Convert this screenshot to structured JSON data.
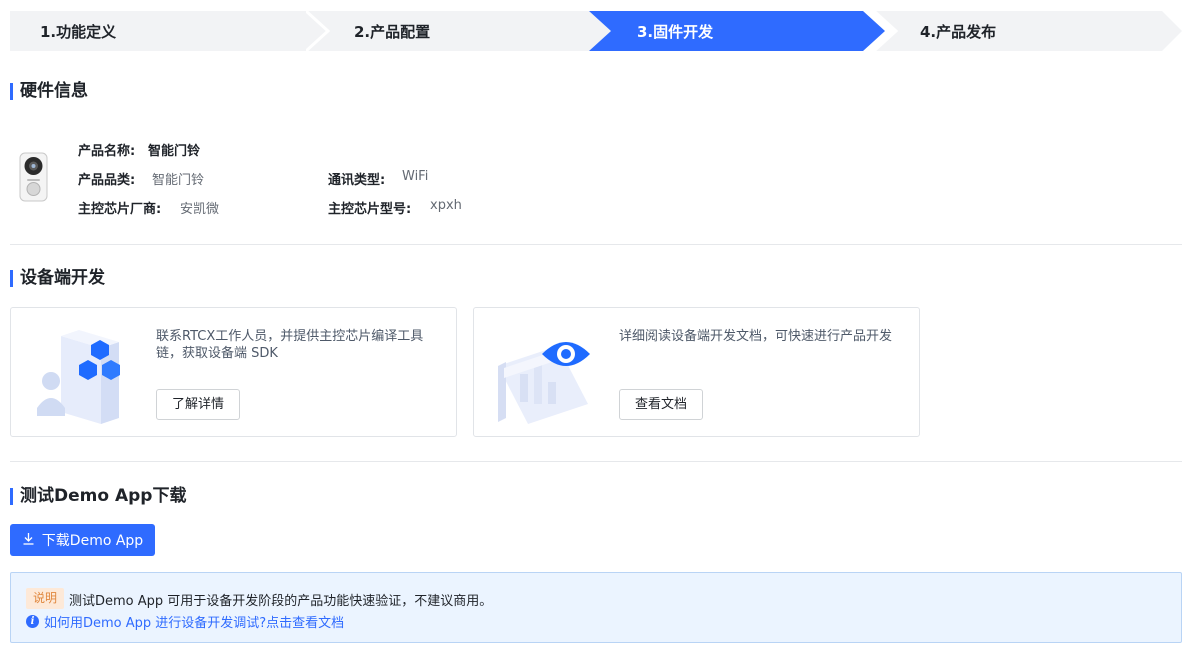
{
  "steps": [
    {
      "label": "1.功能定义",
      "active": false
    },
    {
      "label": "2.产品配置",
      "active": false
    },
    {
      "label": "3.固件开发",
      "active": true
    },
    {
      "label": "4.产品发布",
      "active": false
    }
  ],
  "colors": {
    "accent": "#2f6bff",
    "step_inactive": "#f2f3f5",
    "notice_bg": "#ebf4ff",
    "tag_bg": "#fde9d8",
    "tag_text": "#e0873d"
  },
  "hardware": {
    "title": "硬件信息",
    "product_name_label": "产品名称:",
    "product_name_value": "智能门铃",
    "category_label": "产品品类:",
    "category_value": "智能门铃",
    "comm_type_label": "通讯类型:",
    "comm_type_value": "WiFi",
    "chip_vendor_label": "主控芯片厂商:",
    "chip_vendor_value": "安凯微",
    "chip_model_label": "主控芯片型号:",
    "chip_model_value": "xpxh",
    "device_icon": "doorbell-icon"
  },
  "device_dev": {
    "title": "设备端开发",
    "cards": [
      {
        "description": "联系RTCX工作人员，并提供主控芯片编译工具链，获取设备端 SDK",
        "button": "了解详情",
        "icon": "cubes-illustration"
      },
      {
        "description": "详细阅读设备端开发文档，可快速进行产品开发",
        "button": "查看文档",
        "icon": "eye-illustration"
      }
    ]
  },
  "demo": {
    "title": "测试Demo App下载",
    "download_button": "下载Demo App",
    "download_icon": "download-icon",
    "notice_tag": "说明",
    "notice_text": "测试Demo App 可用于设备开发阶段的产品功能快速验证，不建议商用。",
    "notice_link": "如何用Demo App 进行设备开发调试?点击查看文档",
    "info_icon": "info-icon"
  }
}
